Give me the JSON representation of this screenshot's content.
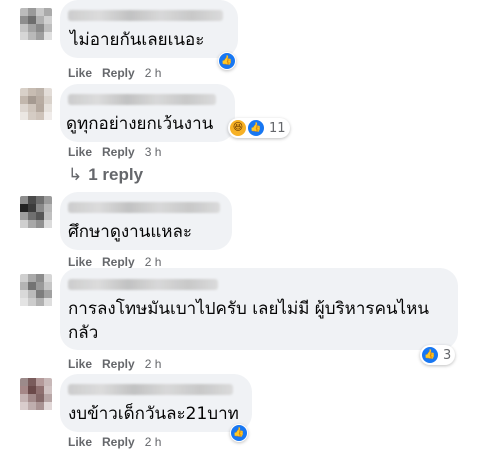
{
  "comments": [
    {
      "text": "ไม่อายกันเลยเนอะ",
      "like": "Like",
      "reply": "Reply",
      "time": "2 h",
      "reactions": {
        "like": true,
        "haha": false,
        "count": ""
      }
    },
    {
      "text": "ดูทุกอย่างยกเว้นงาน",
      "like": "Like",
      "reply": "Reply",
      "time": "3 h",
      "reactions": {
        "like": true,
        "haha": true,
        "count": "11"
      }
    },
    {
      "text": "ศึกษาดูงานแหละ",
      "like": "Like",
      "reply": "Reply",
      "time": "2 h",
      "reactions": {
        "like": false,
        "haha": false,
        "count": ""
      }
    },
    {
      "text_line1": "การลงโทษมันเบาไปครับ เลยไม่มี ผู้บริหารคนไหน",
      "text_line2": "กลัว",
      "like": "Like",
      "reply": "Reply",
      "time": "2 h",
      "reactions": {
        "like": true,
        "haha": false,
        "count": "3"
      }
    },
    {
      "text": "งบข้าวเด็กวันละ21บาท",
      "like": "Like",
      "reply": "Reply",
      "time": "2 h",
      "reactions": {
        "like": true,
        "haha": false,
        "count": ""
      }
    }
  ],
  "replies_link": "1 reply",
  "icons": {
    "like": "thumbs-up-icon",
    "haha": "laughing-face-icon",
    "reply_arrow": "reply-arrow-icon"
  },
  "colors": {
    "bubble": "#f0f2f5",
    "meta_text": "#65676b",
    "like_blue": "#1877f2"
  }
}
